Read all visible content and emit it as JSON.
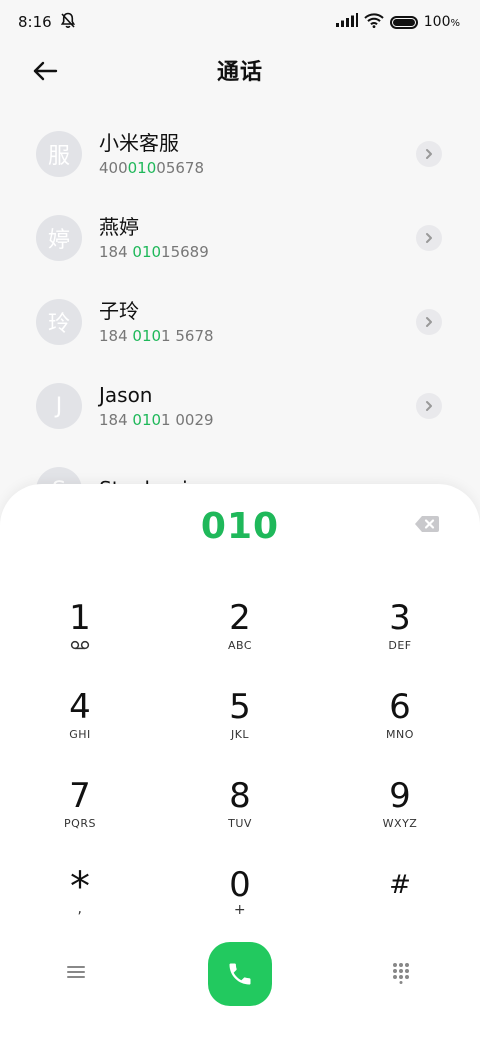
{
  "status_bar": {
    "time": "8:16",
    "battery_pct": "100",
    "battery_suffix": "%"
  },
  "header": {
    "title": "通话"
  },
  "contacts": [
    {
      "avatar": "服",
      "name": "小米客服",
      "num_pre": "400",
      "num_hl": "010",
      "num_post": "05678"
    },
    {
      "avatar": "婷",
      "name": "燕婷",
      "num_pre": "184 ",
      "num_hl": "010",
      "num_post": "15689"
    },
    {
      "avatar": "玲",
      "name": "子玲",
      "num_pre": "184 ",
      "num_hl": "010",
      "num_post": "1 5678"
    },
    {
      "avatar": "J",
      "name": "Jason",
      "num_pre": "184 ",
      "num_hl": "010",
      "num_post": "1 0029"
    },
    {
      "avatar": "S",
      "name": "Stephanie",
      "num_pre": "",
      "num_hl": "",
      "num_post": ""
    }
  ],
  "dialpad": {
    "input_value": "010",
    "keys": [
      {
        "digit": "1",
        "letters": ""
      },
      {
        "digit": "2",
        "letters": "ABC"
      },
      {
        "digit": "3",
        "letters": "DEF"
      },
      {
        "digit": "4",
        "letters": "GHI"
      },
      {
        "digit": "5",
        "letters": "JKL"
      },
      {
        "digit": "6",
        "letters": "MNO"
      },
      {
        "digit": "7",
        "letters": "PQRS"
      },
      {
        "digit": "8",
        "letters": "TUV"
      },
      {
        "digit": "9",
        "letters": "WXYZ"
      },
      {
        "digit": "*",
        "letters": ","
      },
      {
        "digit": "0",
        "letters": "+"
      },
      {
        "digit": "#",
        "letters": ""
      }
    ]
  },
  "colors": {
    "accent": "#1fb85a",
    "call_button": "#22c95f",
    "avatar_bg": "#e2e3e7"
  },
  "icons": {
    "back": "arrow-left-icon",
    "voicemail": "voicemail-icon",
    "backspace": "backspace-icon",
    "call": "phone-icon",
    "menu": "menu-icon",
    "dialpad_toggle": "dialpad-grid-icon"
  }
}
